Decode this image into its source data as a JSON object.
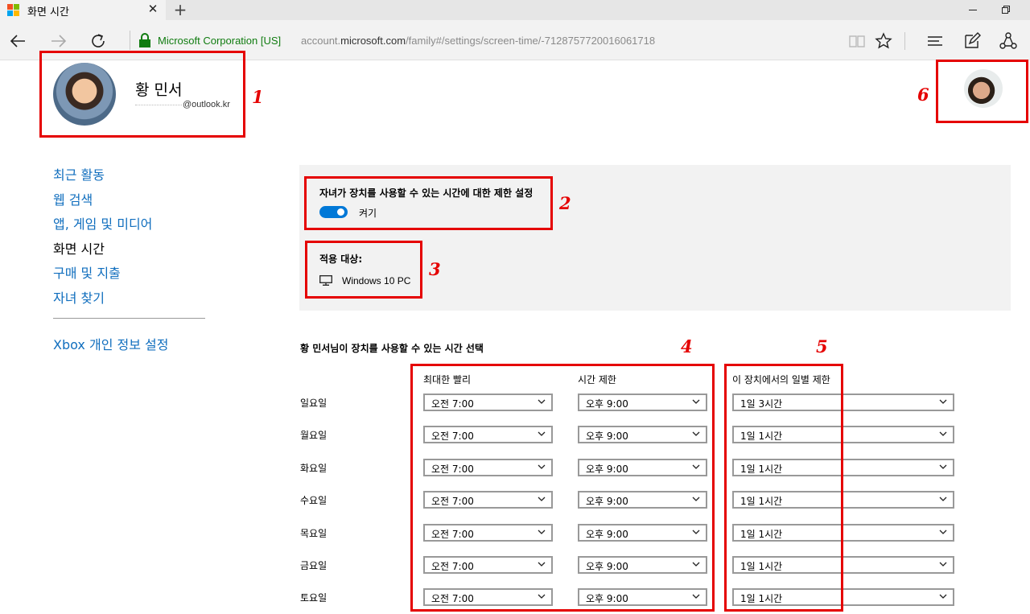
{
  "browser": {
    "tab_title": "화면 시간",
    "tab_close": "✕",
    "new_tab": "+",
    "address_org": "Microsoft Corporation [US]",
    "address_url_prefix": "account.",
    "address_url_domain": "microsoft.com",
    "address_url_path": "/family#/settings/screen-time/-7128757720016061718"
  },
  "profile": {
    "name": "황 민서",
    "email_suffix": "@outlook.kr"
  },
  "sidenav": {
    "items": [
      "최근 활동",
      "웹 검색",
      "앱, 게임 및 미디어",
      "화면 시간",
      "구매 및 지출",
      "자녀 찾기"
    ],
    "active": "화면 시간",
    "xbox": "Xbox 개인 정보 설정"
  },
  "limits": {
    "title": "자녀가 장치를 사용할 수 있는 시간에 대한 제한 설정",
    "toggle_label": "켜기",
    "toggle_on": true,
    "apply_title": "적용 대상:",
    "device": "Windows 10 PC"
  },
  "schedule": {
    "title": "황 민서님이 장치를 사용할 수 있는 시간 선택",
    "col_earliest": "최대한 빨리",
    "col_limit": "시간 제한",
    "col_daily": "이 장치에서의 일별 제한",
    "days": [
      {
        "day": "일요일",
        "earliest": "오전 7:00",
        "limit": "오후 9:00",
        "daily": "1일 3시간"
      },
      {
        "day": "월요일",
        "earliest": "오전 7:00",
        "limit": "오후 9:00",
        "daily": "1일 1시간"
      },
      {
        "day": "화요일",
        "earliest": "오전 7:00",
        "limit": "오후 9:00",
        "daily": "1일 1시간"
      },
      {
        "day": "수요일",
        "earliest": "오전 7:00",
        "limit": "오후 9:00",
        "daily": "1일 1시간"
      },
      {
        "day": "목요일",
        "earliest": "오전 7:00",
        "limit": "오후 9:00",
        "daily": "1일 1시간"
      },
      {
        "day": "금요일",
        "earliest": "오전 7:00",
        "limit": "오후 9:00",
        "daily": "1일 1시간"
      },
      {
        "day": "토요일",
        "earliest": "오전 7:00",
        "limit": "오후 9:00",
        "daily": "1일 1시간"
      }
    ]
  },
  "annotations": [
    "1",
    "2",
    "3",
    "4",
    "5",
    "6"
  ],
  "colors": {
    "accent": "#0078d7",
    "link": "#106ebe",
    "annotation": "#e50000",
    "secure": "#107c10"
  }
}
